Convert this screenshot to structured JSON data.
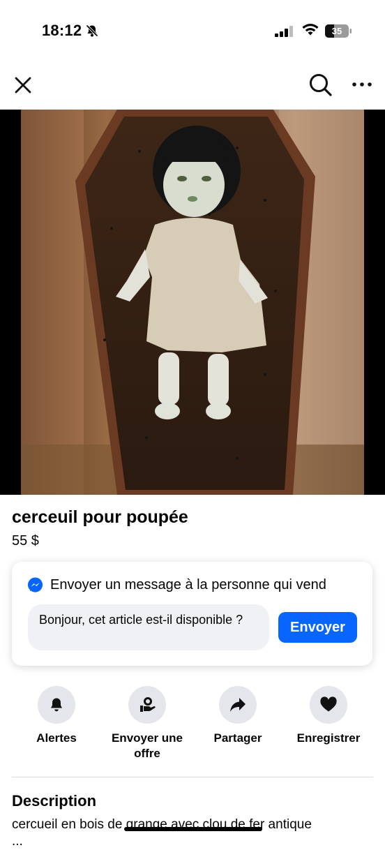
{
  "status_bar": {
    "time": "18:12",
    "battery": "35"
  },
  "colors": {
    "accent": "#0866ff",
    "chip_bg": "#e4e6eb",
    "input_bg": "#eff1f4"
  },
  "nav": {
    "icons": [
      "close-icon",
      "search-icon",
      "more-icon"
    ]
  },
  "listing": {
    "photo_pages": 4,
    "photo_active_index": 3,
    "title": "cerceuil pour poupée",
    "price": "55 $"
  },
  "message": {
    "heading": "Envoyer un message à la personne qui vend",
    "input_value": "Bonjour, cet article est-il disponible ?",
    "send_label": "Envoyer"
  },
  "actions": [
    {
      "label": "Alertes",
      "icon": "bell-icon"
    },
    {
      "label": "Envoyer une offre",
      "icon": "offer-icon"
    },
    {
      "label": "Partager",
      "icon": "share-icon"
    },
    {
      "label": "Enregistrer",
      "icon": "heart-icon"
    }
  ],
  "description": {
    "heading": "Description",
    "text": "cercueil en bois de grange avec clou de fer antique",
    "text_continued": "..."
  }
}
